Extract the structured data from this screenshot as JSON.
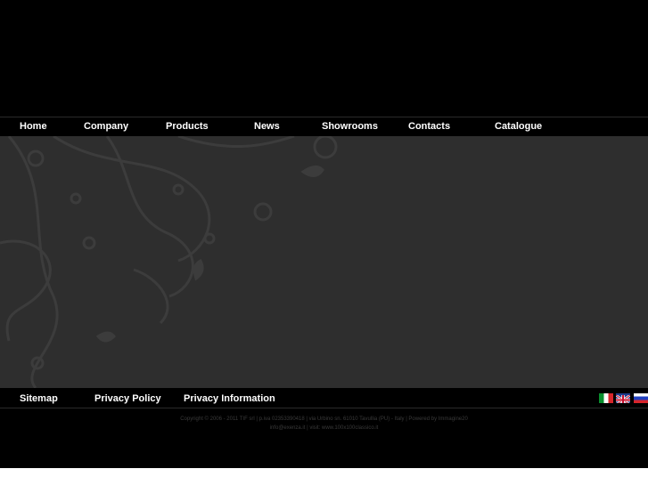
{
  "nav": {
    "items": [
      {
        "label": "Home"
      },
      {
        "label": "Company"
      },
      {
        "label": "Products"
      },
      {
        "label": "News"
      },
      {
        "label": "Showrooms"
      },
      {
        "label": "Contacts"
      },
      {
        "label": "Catalogue"
      }
    ]
  },
  "footer": {
    "links": [
      {
        "label": "Sitemap"
      },
      {
        "label": "Privacy Policy"
      },
      {
        "label": "Privacy Information"
      }
    ],
    "languages": [
      {
        "icon": "italy-flag-icon"
      },
      {
        "icon": "uk-flag-icon"
      },
      {
        "icon": "russia-flag-icon"
      }
    ],
    "copyright_line1": "Copyright © 2006 - 2011  TIF srl | p.iva 02353390418 | via Urbino sn. 61010  Tavullia (PU) - Italy | Powered by Immagine20",
    "copyright_line2": "info@exenza.it | visit: www.100x100classico.it"
  },
  "colors": {
    "background": "#000000",
    "content": "#2e2e2e",
    "text": "#ffffff"
  }
}
